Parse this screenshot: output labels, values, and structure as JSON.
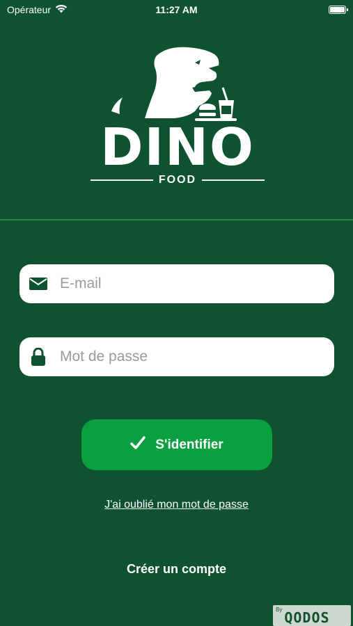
{
  "status_bar": {
    "carrier": "Opérateur",
    "time": "11:27 AM"
  },
  "logo": {
    "name": "DINO",
    "subtitle": "FOOD"
  },
  "form": {
    "email_placeholder": "E-mail",
    "password_placeholder": "Mot de passe",
    "login_label": "S'identifier",
    "forgot_label": "J'ai oublié mon mot de passe",
    "create_label": "Créer un compte"
  },
  "badge": {
    "by": "By",
    "name": "QODOS"
  },
  "colors": {
    "background": "#0e5230",
    "button": "#0aa041",
    "divider": "#1e8b4a"
  }
}
